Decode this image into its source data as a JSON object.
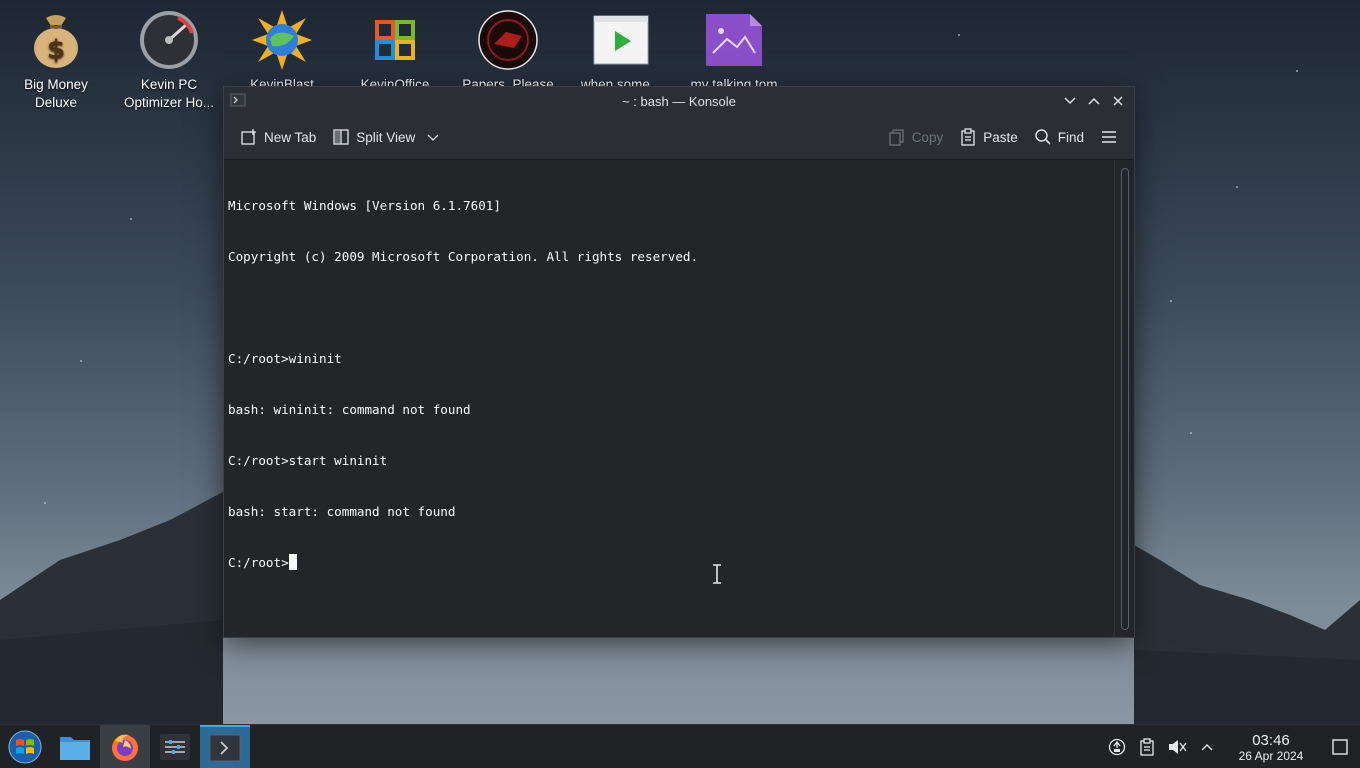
{
  "desktop": {
    "icons": [
      {
        "label": "Big Money\nDeluxe"
      },
      {
        "label": "Kevin PC\nOptimizer Ho..."
      },
      {
        "label": "KevinBlast"
      },
      {
        "label": "KevinOffice"
      },
      {
        "label": "Papers, Please"
      },
      {
        "label": "when some..."
      },
      {
        "label": "my talking tom"
      }
    ]
  },
  "window": {
    "title": "~ : bash — Konsole",
    "toolbar": {
      "new_tab": "New Tab",
      "split_view": "Split View",
      "copy": "Copy",
      "paste": "Paste",
      "find": "Find"
    },
    "terminal": {
      "lines": [
        "Microsoft Windows [Version 6.1.7601]",
        "Copyright (c) 2009 Microsoft Corporation. All rights reserved.",
        "",
        "C:/root>wininit",
        "bash: wininit: command not found",
        "C:/root>start wininit",
        "bash: start: command not found"
      ],
      "prompt": "C:/root>"
    }
  },
  "taskbar": {
    "clock": {
      "time": "03:46",
      "date": "26 Apr 2024"
    }
  },
  "colors": {
    "accent": "#3daee9",
    "terminal_bg": "#232629",
    "panel_bg": "#202326"
  }
}
